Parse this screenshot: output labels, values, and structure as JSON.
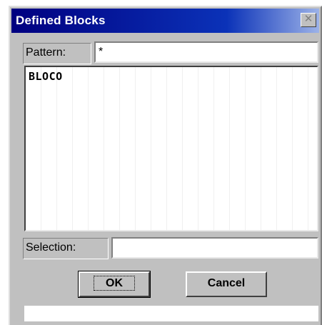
{
  "window": {
    "title": "Defined Blocks"
  },
  "pattern": {
    "label": "Pattern:",
    "value": "*"
  },
  "blocks": {
    "items": [
      "BLOCO"
    ]
  },
  "selection": {
    "label": "Selection:",
    "value": ""
  },
  "buttons": {
    "ok": "OK",
    "cancel": "Cancel"
  },
  "colors": {
    "titlebar": "#000080",
    "dialog_bg": "#c0c0c0"
  },
  "icons": {
    "close": "close-icon"
  }
}
